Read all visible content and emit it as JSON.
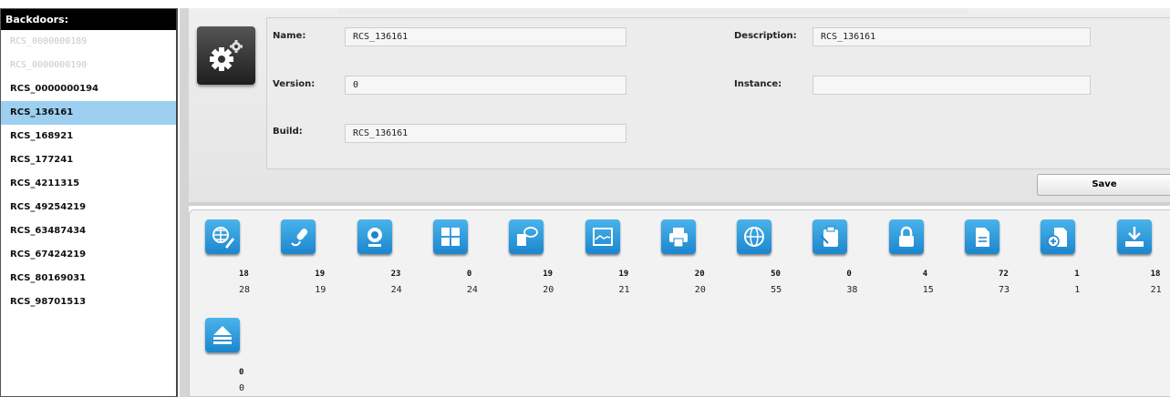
{
  "sidebar": {
    "title": "Backdoors:",
    "items": [
      {
        "label": "RCS_0000000189",
        "state": "disabled"
      },
      {
        "label": "RCS_0000000190",
        "state": "disabled"
      },
      {
        "label": "RCS_0000000194",
        "state": "normal"
      },
      {
        "label": "RCS_136161",
        "state": "selected"
      },
      {
        "label": "RCS_168921",
        "state": "normal"
      },
      {
        "label": "RCS_177241",
        "state": "normal"
      },
      {
        "label": "RCS_4211315",
        "state": "normal"
      },
      {
        "label": "RCS_49254219",
        "state": "normal"
      },
      {
        "label": "RCS_63487434",
        "state": "normal"
      },
      {
        "label": "RCS_67424219",
        "state": "normal"
      },
      {
        "label": "RCS_80169031",
        "state": "normal"
      },
      {
        "label": "RCS_98701513",
        "state": "normal"
      }
    ]
  },
  "form": {
    "name_label": "Name:",
    "name_value": "RCS_136161",
    "description_label": "Description:",
    "description_value": "RCS_136161",
    "version_label": "Version:",
    "version_value": "0",
    "instance_label": "Instance:",
    "instance_value": "",
    "build_label": "Build:",
    "build_value": "RCS_136161",
    "save_label": "Save"
  },
  "modules": [
    {
      "icon": "globe-pen-icon",
      "count1": "18",
      "count2": "28"
    },
    {
      "icon": "microphone-icon",
      "count1": "19",
      "count2": "19"
    },
    {
      "icon": "webcam-icon",
      "count1": "23",
      "count2": "24"
    },
    {
      "icon": "keyboard-icon",
      "count1": "0",
      "count2": "24"
    },
    {
      "icon": "chat-icon",
      "count1": "19",
      "count2": "20"
    },
    {
      "icon": "screenshot-icon",
      "count1": "19",
      "count2": "21"
    },
    {
      "icon": "printer-icon",
      "count1": "20",
      "count2": "20"
    },
    {
      "icon": "globe-icon",
      "count1": "50",
      "count2": "55"
    },
    {
      "icon": "clipboard-icon",
      "count1": "0",
      "count2": "38"
    },
    {
      "icon": "lock-icon",
      "count1": "4",
      "count2": "15"
    },
    {
      "icon": "document-icon",
      "count1": "72",
      "count2": "73"
    },
    {
      "icon": "add-document-icon",
      "count1": "1",
      "count2": "1"
    },
    {
      "icon": "download-icon",
      "count1": "18",
      "count2": "21"
    },
    {
      "icon": "upload-icon",
      "count1": "0",
      "count2": "0"
    }
  ],
  "colors": {
    "selected": "#9ccff0",
    "icon_blue": "#2a9be0",
    "header_black": "#000000"
  }
}
